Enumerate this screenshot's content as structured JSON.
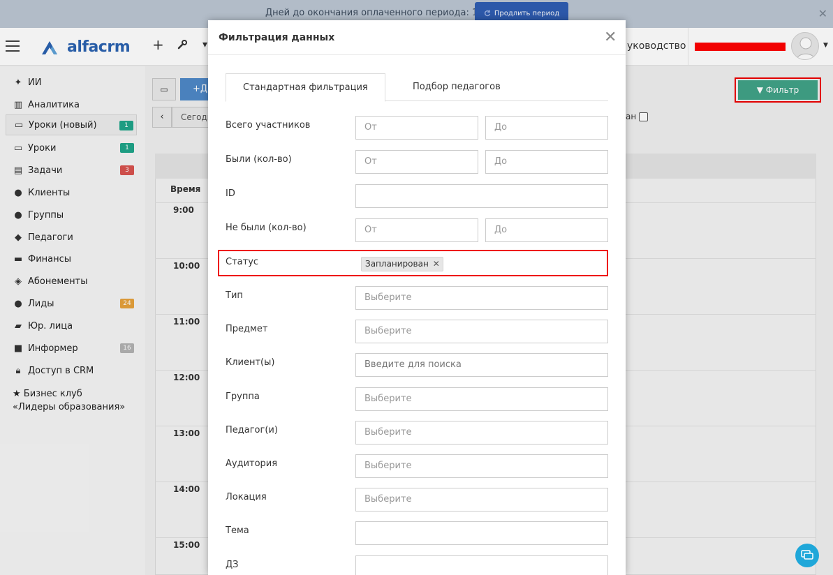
{
  "banner": {
    "text": "Дней до окончания оплаченного периода: 10",
    "button_label": "Продлить период"
  },
  "header": {
    "logo_text": "alfacrm",
    "guide_label": "уководство"
  },
  "sidebar": {
    "items": [
      {
        "label": "ИИ",
        "icon": "sparkle-icon"
      },
      {
        "label": "Аналитика",
        "icon": "map-icon"
      },
      {
        "label": "Уроки (новый)",
        "icon": "calendar-icon",
        "badge": "1",
        "badge_color": "#1fa58a"
      },
      {
        "label": "Уроки",
        "icon": "calendar-icon",
        "badge": "1",
        "badge_color": "#1fa58a"
      },
      {
        "label": "Задачи",
        "icon": "clipboard-icon",
        "badge": "3",
        "badge_color": "#d9534f"
      },
      {
        "label": "Клиенты",
        "icon": "user-icon"
      },
      {
        "label": "Группы",
        "icon": "users-icon"
      },
      {
        "label": "Педагоги",
        "icon": "graduation-cap-icon"
      },
      {
        "label": "Финансы",
        "icon": "money-icon"
      },
      {
        "label": "Абонементы",
        "icon": "tag-icon"
      },
      {
        "label": "Лиды",
        "icon": "user-plus-icon",
        "badge": "24",
        "badge_color": "#e6a23c"
      },
      {
        "label": "Юр. лица",
        "icon": "briefcase-icon"
      },
      {
        "label": "Информер",
        "icon": "square-icon",
        "badge": "16",
        "badge_color": "#b3b3b3"
      },
      {
        "label": "Доступ в CRM",
        "icon": "lock-icon"
      }
    ],
    "club_line1": "Бизнес клуб",
    "club_line2": "«Лидеры образования»"
  },
  "background": {
    "add_label": "+Д",
    "today_label": "Сегодн",
    "filter_label": "Фильтр",
    "check_label": "ан",
    "time_header": "Время",
    "times": [
      "9:00",
      "10:00",
      "11:00",
      "12:00",
      "13:00",
      "14:00",
      "15:00"
    ]
  },
  "modal": {
    "title": "Фильтрация данных",
    "tabs": [
      "Стандартная фильтрация",
      "Подбор педагогов"
    ],
    "rows": {
      "total": {
        "label": "Всего участников",
        "from": "От",
        "to": "До"
      },
      "attended": {
        "label": "Были (кол-во)",
        "from": "От",
        "to": "До"
      },
      "id": {
        "label": "ID",
        "value": ""
      },
      "absent": {
        "label": "Не были (кол-во)",
        "from": "От",
        "to": "До"
      },
      "status": {
        "label": "Статус",
        "chip": "Запланирован"
      },
      "type": {
        "label": "Тип",
        "placeholder": "Выберите"
      },
      "subject": {
        "label": "Предмет",
        "placeholder": "Выберите"
      },
      "client": {
        "label": "Клиент(ы)",
        "placeholder": "Введите для поиска"
      },
      "group": {
        "label": "Группа",
        "placeholder": "Выберите"
      },
      "teacher": {
        "label": "Педагог(и)",
        "placeholder": "Выберите"
      },
      "room": {
        "label": "Аудитория",
        "placeholder": "Выберите"
      },
      "location": {
        "label": "Локация",
        "placeholder": "Выберите"
      },
      "topic": {
        "label": "Тема",
        "value": ""
      },
      "homework": {
        "label": "ДЗ",
        "value": ""
      }
    }
  }
}
